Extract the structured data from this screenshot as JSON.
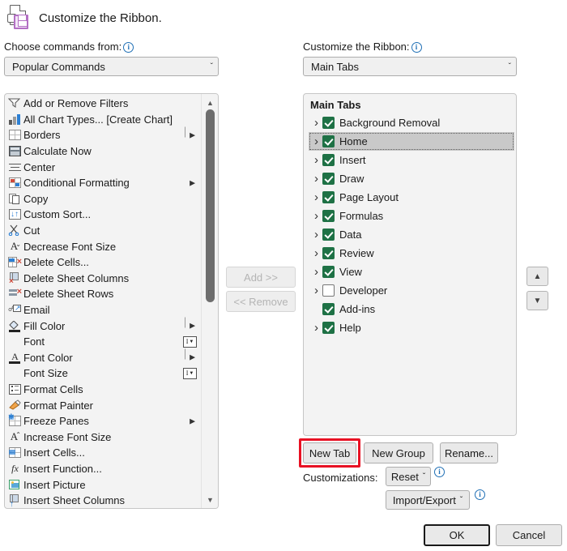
{
  "dialog": {
    "title": "Customize the Ribbon.",
    "title_icon": "customize-ribbon-icon"
  },
  "left_panel": {
    "label": "Choose commands from:",
    "label_info_icon": "info-icon",
    "combo_value": "Popular Commands",
    "combo_arrow": "ˇ",
    "commands": [
      {
        "label": "Add or Remove Filters",
        "icon": "filter-icon",
        "submenu": false,
        "control": null
      },
      {
        "label": "All Chart Types... [Create Chart]",
        "icon": "chart-icon",
        "submenu": false,
        "control": null
      },
      {
        "label": "Borders",
        "icon": "borders-icon",
        "submenu": true,
        "bar": true,
        "control": null
      },
      {
        "label": "Calculate Now",
        "icon": "calculator-icon",
        "submenu": false,
        "control": null
      },
      {
        "label": "Center",
        "icon": "align-center-icon",
        "submenu": false,
        "control": null
      },
      {
        "label": "Conditional Formatting",
        "icon": "conditional-formatting-icon",
        "submenu": true,
        "bar": false,
        "control": null
      },
      {
        "label": "Copy",
        "icon": "copy-icon",
        "submenu": false,
        "control": null
      },
      {
        "label": "Custom Sort...",
        "icon": "sort-icon",
        "submenu": false,
        "control": null
      },
      {
        "label": "Cut",
        "icon": "scissors-icon",
        "submenu": false,
        "control": null
      },
      {
        "label": "Decrease Font Size",
        "icon": "decrease-font-size-icon",
        "submenu": false,
        "control": null
      },
      {
        "label": "Delete Cells...",
        "icon": "delete-cells-icon",
        "submenu": false,
        "control": null
      },
      {
        "label": "Delete Sheet Columns",
        "icon": "delete-sheet-columns-icon",
        "submenu": false,
        "control": null
      },
      {
        "label": "Delete Sheet Rows",
        "icon": "delete-sheet-rows-icon",
        "submenu": false,
        "control": null
      },
      {
        "label": "Email",
        "icon": "email-icon",
        "submenu": false,
        "control": null
      },
      {
        "label": "Fill Color",
        "icon": "fill-color-icon",
        "submenu": true,
        "bar": true,
        "control": null
      },
      {
        "label": "Font",
        "icon": "none",
        "submenu": false,
        "control": "combo-box"
      },
      {
        "label": "Font Color",
        "icon": "font-color-icon",
        "submenu": true,
        "bar": true,
        "control": null
      },
      {
        "label": "Font Size",
        "icon": "none",
        "submenu": false,
        "control": "combo-box"
      },
      {
        "label": "Format Cells",
        "icon": "format-cells-icon",
        "submenu": false,
        "control": null
      },
      {
        "label": "Format Painter",
        "icon": "format-painter-icon",
        "submenu": false,
        "control": null
      },
      {
        "label": "Freeze Panes",
        "icon": "freeze-panes-icon",
        "submenu": true,
        "bar": false,
        "control": null
      },
      {
        "label": "Increase Font Size",
        "icon": "increase-font-size-icon",
        "submenu": false,
        "control": null
      },
      {
        "label": "Insert Cells...",
        "icon": "insert-cells-icon",
        "submenu": false,
        "control": null
      },
      {
        "label": "Insert Function...",
        "icon": "insert-function-icon",
        "submenu": false,
        "control": null
      },
      {
        "label": "Insert Picture",
        "icon": "insert-picture-icon",
        "submenu": false,
        "control": null
      },
      {
        "label": "Insert Sheet Columns",
        "icon": "insert-sheet-columns-icon",
        "submenu": false,
        "control": null
      }
    ],
    "scrollbar": {
      "up_arrow": "▲",
      "down_arrow": "▼"
    }
  },
  "transfer": {
    "add_label": "Add >>",
    "remove_label": "<< Remove",
    "add_enabled": false,
    "remove_enabled": false
  },
  "right_panel": {
    "label": "Customize the Ribbon:",
    "label_info_icon": "info-icon",
    "combo_value": "Main Tabs",
    "combo_arrow": "ˇ",
    "tree_header": "Main Tabs",
    "tabs": [
      {
        "label": "Background Removal",
        "checked": true,
        "expandable": true,
        "selected": false
      },
      {
        "label": "Home",
        "checked": true,
        "expandable": true,
        "selected": true
      },
      {
        "label": "Insert",
        "checked": true,
        "expandable": true,
        "selected": false
      },
      {
        "label": "Draw",
        "checked": true,
        "expandable": true,
        "selected": false
      },
      {
        "label": "Page Layout",
        "checked": true,
        "expandable": true,
        "selected": false
      },
      {
        "label": "Formulas",
        "checked": true,
        "expandable": true,
        "selected": false
      },
      {
        "label": "Data",
        "checked": true,
        "expandable": true,
        "selected": false
      },
      {
        "label": "Review",
        "checked": true,
        "expandable": true,
        "selected": false
      },
      {
        "label": "View",
        "checked": true,
        "expandable": true,
        "selected": false
      },
      {
        "label": "Developer",
        "checked": false,
        "expandable": true,
        "selected": false
      },
      {
        "label": "Add-ins",
        "checked": true,
        "expandable": false,
        "selected": false
      },
      {
        "label": "Help",
        "checked": true,
        "expandable": true,
        "selected": false
      }
    ],
    "move_up_icon": "▲",
    "move_down_icon": "▼"
  },
  "actions": {
    "new_tab": "New Tab",
    "new_group": "New Group",
    "rename": "Rename...",
    "customizations_label": "Customizations:",
    "reset": "Reset",
    "reset_arrow": "ˇ",
    "import_export": "Import/Export",
    "import_export_arrow": "ˇ",
    "ok": "OK",
    "cancel": "Cancel"
  },
  "highlight": {
    "target": "new-tab-button",
    "color": "#e81123"
  }
}
